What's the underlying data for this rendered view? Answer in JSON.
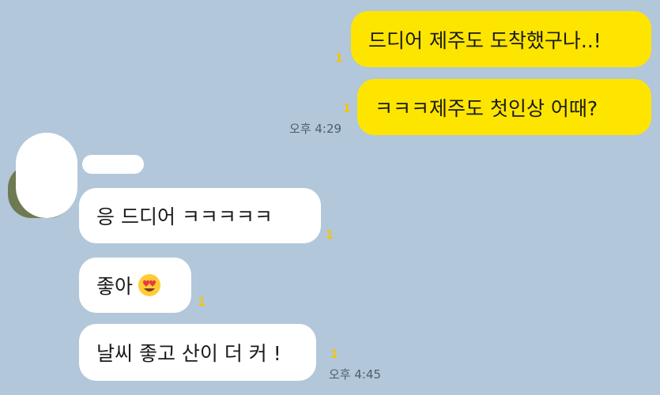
{
  "messages": {
    "mine": [
      {
        "text": "드디어 제주도 도착했구나..!",
        "unread": "1"
      },
      {
        "text": "ㅋㅋㅋ제주도 첫인상 어때?",
        "unread": "1",
        "time": "오후 4:29"
      }
    ],
    "theirs": [
      {
        "text": "응 드디어 ㅋㅋㅋㅋㅋ",
        "unread": "1"
      },
      {
        "text": "좋아",
        "emoji": "heart-eyes-emoji",
        "unread": "1"
      },
      {
        "text": "날씨 좋고 산이 더 커 !",
        "unread": "1",
        "time": "오후 4:45"
      }
    ]
  },
  "colors": {
    "background": "#b2c7d9",
    "my_bubble": "#fee500",
    "their_bubble": "#ffffff",
    "unread": "#f5c400"
  }
}
